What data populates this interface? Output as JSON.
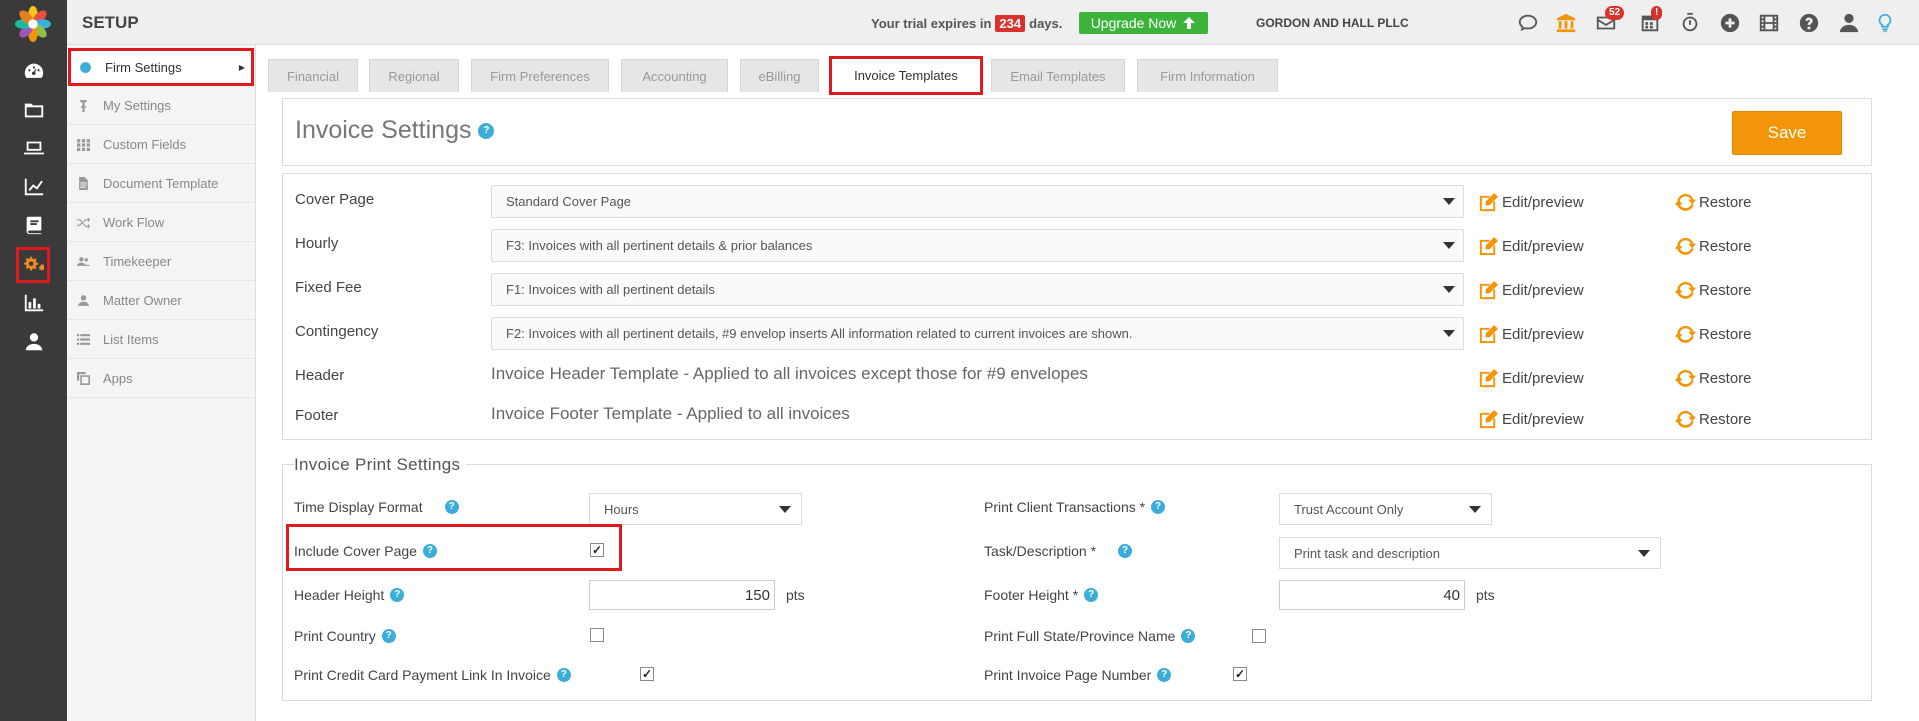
{
  "topbar": {
    "section_title": "SETUP",
    "trial_prefix": "Your trial expires in",
    "trial_days": "234",
    "trial_suffix": "days.",
    "upgrade_label": "Upgrade Now",
    "firm_name": "GORDON AND HALL PLLC",
    "mail_count": "52",
    "calendar_badge": "!"
  },
  "sidebar": {
    "items": [
      {
        "label": "Firm Settings",
        "icon": "dot-icon"
      },
      {
        "label": "My Settings",
        "icon": "pin-icon"
      },
      {
        "label": "Custom Fields",
        "icon": "grid-icon"
      },
      {
        "label": "Document Template",
        "icon": "document-icon"
      },
      {
        "label": "Work Flow",
        "icon": "shuffle-icon"
      },
      {
        "label": "Timekeeper",
        "icon": "users-icon"
      },
      {
        "label": "Matter Owner",
        "icon": "user-icon"
      },
      {
        "label": "List Items",
        "icon": "list-icon"
      },
      {
        "label": "Apps",
        "icon": "copy-icon"
      }
    ]
  },
  "tabs": [
    {
      "label": "Financial"
    },
    {
      "label": "Regional"
    },
    {
      "label": "Firm Preferences"
    },
    {
      "label": "Accounting"
    },
    {
      "label": "eBilling"
    },
    {
      "label": "Invoice Templates"
    },
    {
      "label": "Email Templates"
    },
    {
      "label": "Firm Information"
    }
  ],
  "invoice_settings": {
    "title": "Invoice Settings",
    "save_label": "Save",
    "edit_label": "Edit/preview",
    "restore_label": "Restore",
    "rows": [
      {
        "label": "Cover Page",
        "value": "Standard Cover Page"
      },
      {
        "label": "Hourly",
        "value": "F3: Invoices with all pertinent details & prior balances"
      },
      {
        "label": "Fixed Fee",
        "value": "F1: Invoices with all pertinent details"
      },
      {
        "label": "Contingency",
        "value": "F2: Invoices with all pertinent details, #9 envelop inserts All information related to current invoices are shown."
      },
      {
        "label": "Header",
        "value": "Invoice Header Template - Applied to all invoices except those for #9 envelopes"
      },
      {
        "label": "Footer",
        "value": "Invoice Footer Template - Applied to all invoices"
      }
    ]
  },
  "print_settings": {
    "title": "Invoice Print Settings",
    "time_display_label": "Time Display Format",
    "time_display_value": "Hours",
    "include_cover_label": "Include Cover Page",
    "include_cover_checked": true,
    "header_height_label": "Header Height",
    "header_height_value": "150",
    "print_country_label": "Print Country",
    "print_country_checked": false,
    "credit_card_label": "Print Credit Card Payment Link In Invoice",
    "credit_card_checked": true,
    "client_transactions_label": "Print Client Transactions *",
    "client_transactions_value": "Trust Account Only",
    "task_description_label": "Task/Description *",
    "task_description_value": "Print task and description",
    "footer_height_label": "Footer Height *",
    "footer_height_value": "40",
    "full_state_label": "Print Full State/Province Name",
    "full_state_checked": false,
    "page_number_label": "Print Invoice Page Number",
    "page_number_checked": true,
    "unit": "pts"
  },
  "colors": {
    "accent_orange": "#f29509",
    "help_blue": "#3aaed8",
    "upgrade_green": "#3cb43c",
    "highlight_red": "#e0191e"
  }
}
